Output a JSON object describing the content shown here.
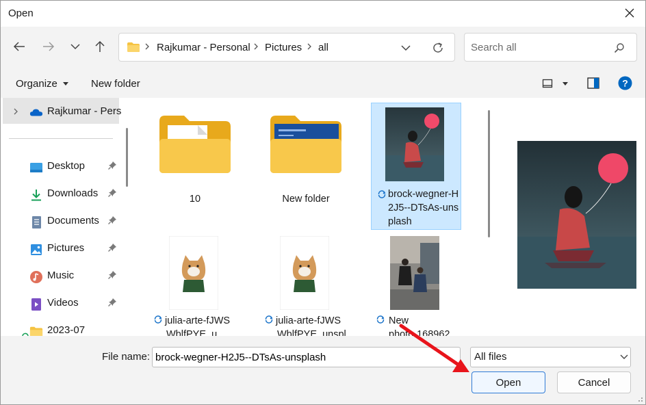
{
  "window": {
    "title": "Open"
  },
  "address": {
    "crumbs": [
      "Rajkumar - Personal",
      "Pictures",
      "all"
    ]
  },
  "search": {
    "placeholder": "Search all"
  },
  "toolbar": {
    "organize_label": "Organize",
    "new_folder_label": "New folder"
  },
  "sidebar": {
    "items": [
      {
        "label": "Rajkumar - Perso",
        "icon": "onedrive-cloud-icon"
      },
      {
        "label": "Desktop",
        "icon": "desktop-icon"
      },
      {
        "label": "Downloads",
        "icon": "download-arrow-icon"
      },
      {
        "label": "Documents",
        "icon": "document-icon"
      },
      {
        "label": "Pictures",
        "icon": "picture-icon"
      },
      {
        "label": "Music",
        "icon": "music-icon"
      },
      {
        "label": "Videos",
        "icon": "video-icon"
      },
      {
        "label": "2023-07",
        "icon": "folder-icon"
      }
    ]
  },
  "files": [
    {
      "name": "10",
      "kind": "folder"
    },
    {
      "name": "New folder",
      "kind": "folder"
    },
    {
      "name": "brock-wegner-H2J5--DTsAs-unsplash",
      "kind": "image",
      "selected": true
    },
    {
      "name": "julia-arte-fJWS",
      "name_line2": "WblfPYE_u",
      "kind": "image"
    },
    {
      "name": "julia-arte-fJWS",
      "name_line2": "WblfPYE_unspl",
      "kind": "image"
    },
    {
      "name": "New",
      "name_line2": "photo-168962",
      "kind": "image"
    }
  ],
  "bottom": {
    "file_name_label": "File name:",
    "file_name_value": "brock-wegner-H2J5--DTsAs-unsplash",
    "file_type_value": "All files",
    "open_label": "Open",
    "cancel_label": "Cancel"
  },
  "colors": {
    "accent": "#0067c0",
    "selection": "#cce8ff",
    "arrow": "#e8141b",
    "folder": "#f5c342"
  }
}
